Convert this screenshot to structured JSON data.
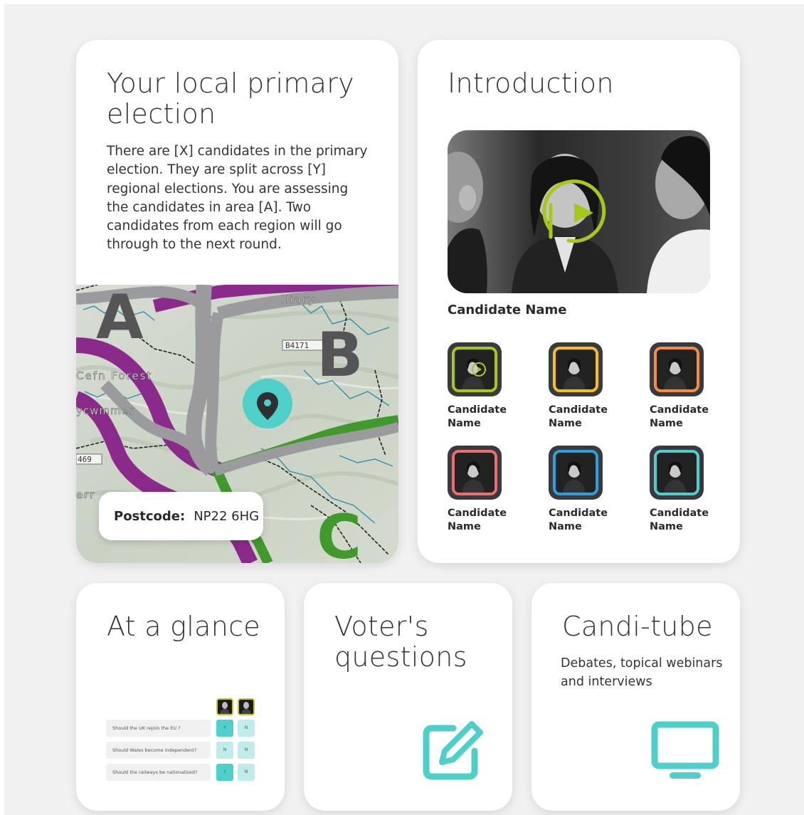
{
  "election": {
    "title": "Your local primary election",
    "description": "There are [X] candidates in the primary election.  They are split across [Y] regional elections.  You are assessing the candidates in area [A].  Two candidates from each region will go through to the next round.",
    "map": {
      "region_labels": [
        "A",
        "B",
        "C"
      ],
      "road_labels": [
        "B4171",
        "469"
      ],
      "place_labels": [
        "Cefn Forest",
        "lliary",
        "ycwmmer",
        "err"
      ]
    },
    "postcode_label": "Postcode:",
    "postcode_value": "NP22 6HG"
  },
  "intro": {
    "title": "Introduction",
    "featured_candidate": "Candidate Name",
    "candidates": [
      {
        "name": "Candidate Name",
        "color": "#a5c918"
      },
      {
        "name": "Candidate Name",
        "color": "#f4c21b"
      },
      {
        "name": "Candidate Name",
        "color": "#f58d3a"
      },
      {
        "name": "Candidate Name",
        "color": "#ee6d72"
      },
      {
        "name": "Candidate Name",
        "color": "#2f9fdc"
      },
      {
        "name": "Candidate Name",
        "color": "#4fcfc9"
      }
    ]
  },
  "glance": {
    "title": "At a glance",
    "questions": [
      {
        "text": "Should the UK rejoin the EU ?",
        "answers": [
          "Y",
          "N"
        ]
      },
      {
        "text": "Should Wales become independent?",
        "answers": [
          "N",
          "N"
        ]
      },
      {
        "text": "Should the railways be nationalized?",
        "answers": [
          "Y",
          "N"
        ]
      }
    ]
  },
  "questions_card": {
    "title": "Voter's questions",
    "icon": "edit-icon"
  },
  "tube": {
    "title": "Candi-tube",
    "description": "Debates, topical webinars and interviews",
    "icon": "monitor-icon"
  },
  "colors": {
    "accent": "#4fcfc9",
    "play": "#a5c918",
    "purple_route": "#8a2a8a",
    "green_route": "#3f9a2b"
  }
}
